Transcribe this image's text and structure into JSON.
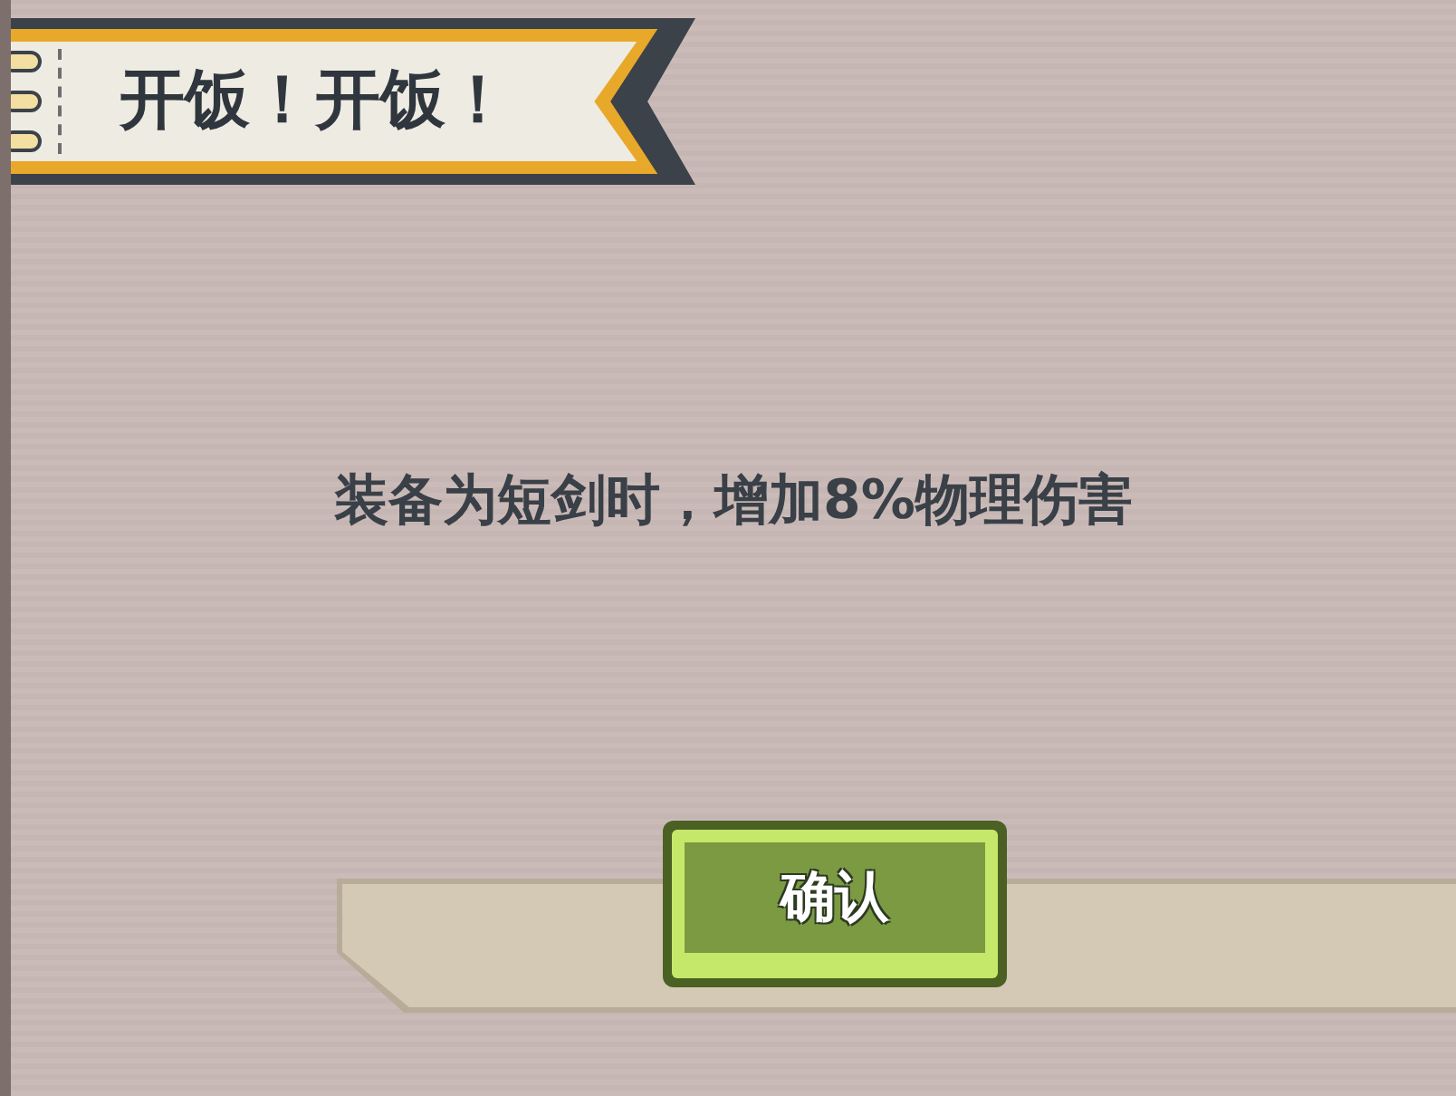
{
  "title": "开饭！开饭！",
  "message": "装备为短剑时，增加8%物理伤害",
  "buttons": [
    "确认"
  ]
}
